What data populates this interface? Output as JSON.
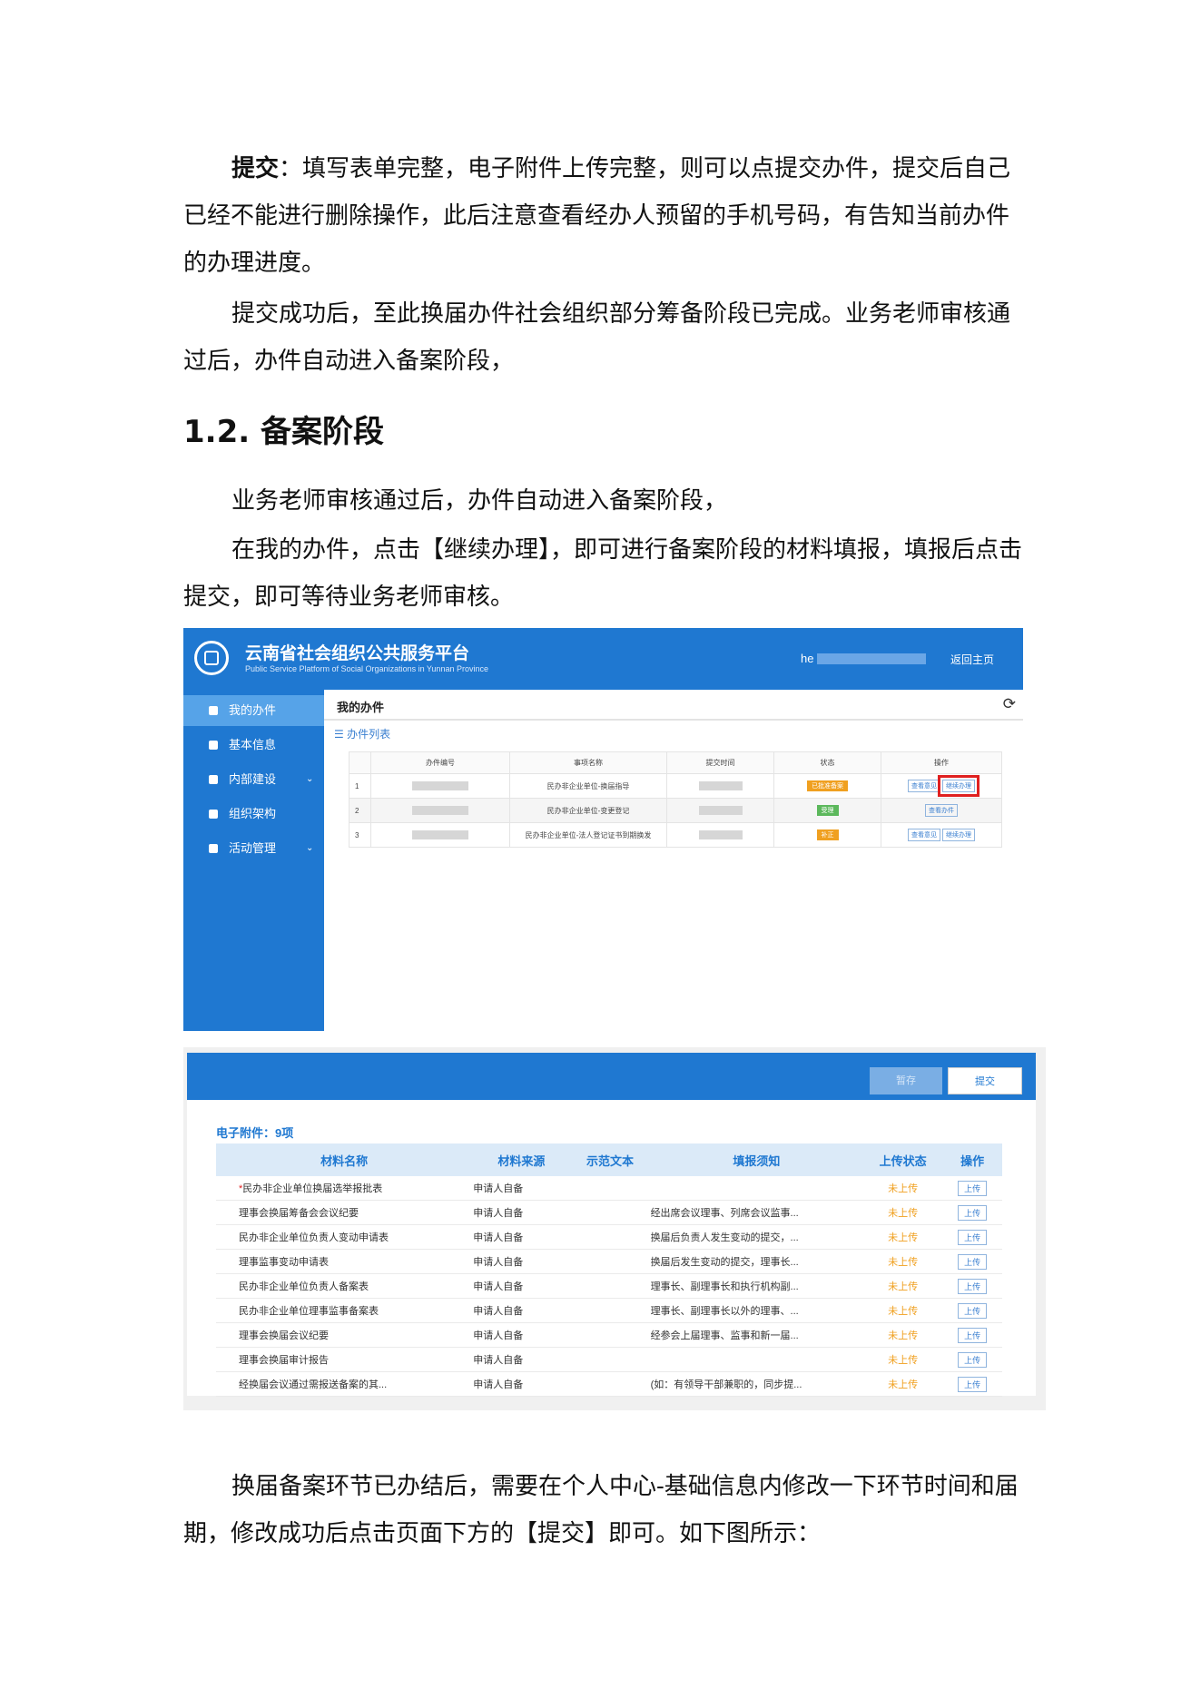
{
  "p1": {
    "bold": "提交",
    "rest": "：填写表单完整，电子附件上传完整，则可以点提交办件，提交后自己已经不能进行删除操作，此后注意查看经办人预留的手机号码，有告知当前办件的办理进度。"
  },
  "p2": "提交成功后，至此换届办件社会组织部分筹备阶段已完成。业务老师审核通过后，办件自动进入备案阶段，",
  "heading": "1.2. 备案阶段",
  "p3": "业务老师审核通过后，办件自动进入备案阶段，",
  "p4": "在我的办件，点击【继续办理】，即可进行备案阶段的材料填报，填报后点击提交，即可等待业务老师审核。",
  "p5": "换届备案环节已办结后，需要在个人中心-基础信息内修改一下环节时间和届期，修改成功后点击页面下方的【提交】即可。如下图所示：",
  "shot1": {
    "title": "云南省社会组织公共服务平台",
    "subtitle": "Public Service Platform of Social Organizations in Yunnan Province",
    "user": "he",
    "home": "返回主页",
    "nav": [
      "我的办件",
      "基本信息",
      "内部建设",
      "组织架构",
      "活动管理"
    ],
    "bar_title": "我的办件",
    "list_label": "☰ 办件列表",
    "columns": [
      "办件编号",
      "事项名称",
      "提交时间",
      "状态",
      "操作"
    ],
    "rows": [
      {
        "num": "1",
        "item": "民办非企业单位-换届指导",
        "status": "已批准备案",
        "status_color": "#f0a020",
        "ops": [
          "查看意见",
          "继续办理"
        ]
      },
      {
        "num": "2",
        "item": "民办非企业单位-变更登记",
        "status": "受理",
        "status_color": "#5cb85c",
        "ops": [
          "查看办件"
        ]
      },
      {
        "num": "3",
        "item": "民办非企业单位-法人登记证书到期换发",
        "status": "补正",
        "status_color": "#f0a020",
        "ops": [
          "查看意见",
          "继续办理"
        ]
      }
    ]
  },
  "shot2": {
    "save": "暂存",
    "submit": "提交",
    "label": "电子附件：9项",
    "columns": [
      "材料名称",
      "材料来源",
      "示范文本",
      "填报须知",
      "上传状态",
      "操作"
    ],
    "rows": [
      {
        "name": "民办非企业单位换届选举报批表",
        "required": "*",
        "source": "申请人自备",
        "notice": "",
        "status": "未上传",
        "op": "上传"
      },
      {
        "name": "理事会换届筹备会会议纪要",
        "required": "",
        "source": "申请人自备",
        "notice": "经出席会议理事、列席会议监事...",
        "status": "未上传",
        "op": "上传"
      },
      {
        "name": "民办非企业单位负责人变动申请表",
        "required": "",
        "source": "申请人自备",
        "notice": "换届后负责人发生变动的提交，...",
        "status": "未上传",
        "op": "上传"
      },
      {
        "name": "理事监事变动申请表",
        "required": "",
        "source": "申请人自备",
        "notice": "换届后发生变动的提交，理事长...",
        "status": "未上传",
        "op": "上传"
      },
      {
        "name": "民办非企业单位负责人备案表",
        "required": "",
        "source": "申请人自备",
        "notice": "理事长、副理事长和执行机构副...",
        "status": "未上传",
        "op": "上传"
      },
      {
        "name": "民办非企业单位理事监事备案表",
        "required": "",
        "source": "申请人自备",
        "notice": "理事长、副理事长以外的理事、...",
        "status": "未上传",
        "op": "上传"
      },
      {
        "name": "理事会换届会议纪要",
        "required": "",
        "source": "申请人自备",
        "notice": "经参会上届理事、监事和新一届...",
        "status": "未上传",
        "op": "上传"
      },
      {
        "name": "理事会换届审计报告",
        "required": "",
        "source": "申请人自备",
        "notice": "",
        "status": "未上传",
        "op": "上传"
      },
      {
        "name": "经换届会议通过需报送备案的其...",
        "required": "",
        "source": "申请人自备",
        "notice": "(如：有领导干部兼职的，同步提...",
        "status": "未上传",
        "op": "上传"
      }
    ]
  }
}
